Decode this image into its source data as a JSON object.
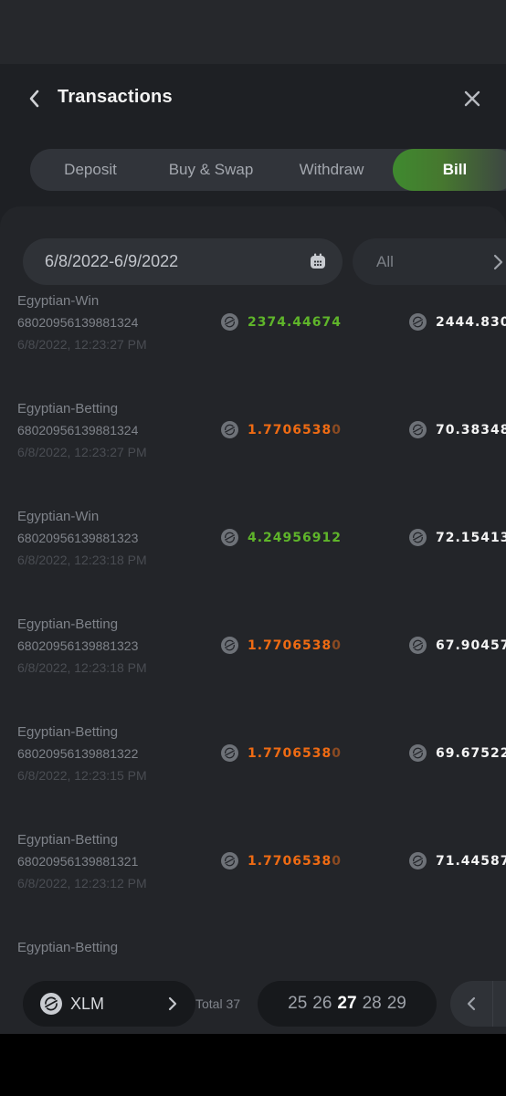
{
  "header": {
    "title": "Transactions"
  },
  "tabs": [
    {
      "label": "Deposit"
    },
    {
      "label": "Buy & Swap"
    },
    {
      "label": "Withdraw"
    },
    {
      "label": "Bill",
      "active": true
    }
  ],
  "filters": {
    "date_range": "6/8/2022-6/9/2022",
    "type": "All"
  },
  "transactions": [
    {
      "name": "Egyptian-Win",
      "order": "68020956139881324",
      "time": "6/8/2022, 12:23:27 PM",
      "amount": "2374.44674",
      "amount_dim": "",
      "amount_color": "green",
      "balance": "2444.830"
    },
    {
      "name": "Egyptian-Betting",
      "order": "68020956139881324",
      "time": "6/8/2022, 12:23:27 PM",
      "amount": "1.7706538",
      "amount_dim": "0",
      "amount_color": "orange",
      "balance": "70.38348"
    },
    {
      "name": "Egyptian-Win",
      "order": "68020956139881323",
      "time": "6/8/2022, 12:23:18 PM",
      "amount": "4.24956912",
      "amount_dim": "",
      "amount_color": "green",
      "balance": "72.15413"
    },
    {
      "name": "Egyptian-Betting",
      "order": "68020956139881323",
      "time": "6/8/2022, 12:23:18 PM",
      "amount": "1.7706538",
      "amount_dim": "0",
      "amount_color": "orange",
      "balance": "67.90457"
    },
    {
      "name": "Egyptian-Betting",
      "order": "68020956139881322",
      "time": "6/8/2022, 12:23:15 PM",
      "amount": "1.7706538",
      "amount_dim": "0",
      "amount_color": "orange",
      "balance": "69.67522"
    },
    {
      "name": "Egyptian-Betting",
      "order": "68020956139881321",
      "time": "6/8/2022, 12:23:12 PM",
      "amount": "1.7706538",
      "amount_dim": "0",
      "amount_color": "orange",
      "balance": "71.44587"
    },
    {
      "name": "Egyptian-Betting",
      "order": "",
      "time": "",
      "amount": "",
      "amount_dim": "",
      "amount_color": "orange",
      "balance": ""
    }
  ],
  "footer": {
    "currency": "XLM",
    "total": "Total 37",
    "pages": [
      "25",
      "26",
      "27",
      "28",
      "29"
    ],
    "current_page": "27"
  },
  "colors": {
    "win": "#5fb52a",
    "bet": "#ef6b13",
    "accent_tab": "#3f8a2f"
  },
  "icons": {
    "back": "chevron-left-icon",
    "close": "close-icon",
    "calendar": "calendar-icon",
    "coin": "stellar-xlm-icon"
  }
}
